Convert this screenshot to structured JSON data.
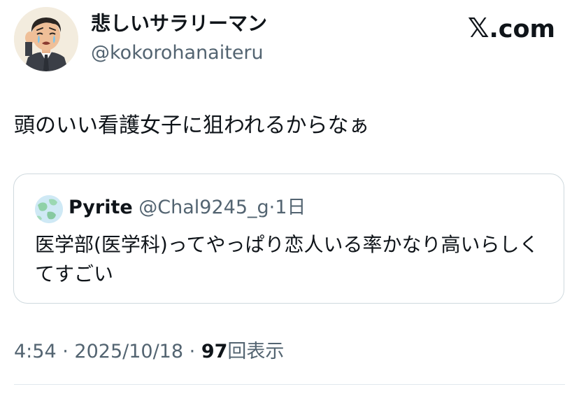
{
  "post": {
    "author": {
      "display_name": "悲しいサラリーマン",
      "handle": "@kokorohanaiteru"
    },
    "brand": {
      "x_glyph": "𝕏",
      "domain": ".com"
    },
    "text": "頭のいい看護女子に狙われるからなぁ",
    "quoted": {
      "display_name": "Pyrite",
      "handle": "@Chal9245_g",
      "separator": "·",
      "age": "1日",
      "text": "医学部(医学科)ってやっぱり恋人いる率かなり高いらしくてすごい"
    },
    "meta": {
      "time": "4:54",
      "separator": "·",
      "date": "2025/10/18",
      "separator2": "·",
      "views_count": "97",
      "views_label": "回表示"
    }
  },
  "colors": {
    "text_primary": "#0f1419",
    "text_secondary": "#536471",
    "border": "#cfd9de"
  },
  "icons": {
    "author_avatar": "crying-salaryman-avatar",
    "quoted_avatar": "globe-map-avatar"
  }
}
